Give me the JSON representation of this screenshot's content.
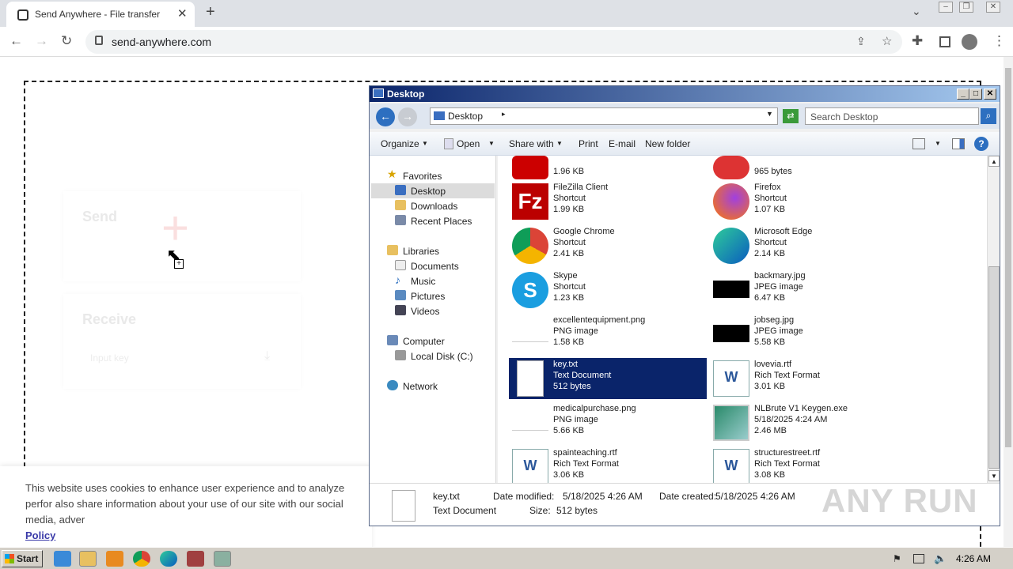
{
  "browser": {
    "tab_title": "Send Anywhere - File transfer",
    "url": "send-anywhere.com",
    "close": "✕",
    "new_tab": "+"
  },
  "page": {
    "send_heading": "Send",
    "receive_heading": "Receive",
    "receive_placeholder": "Input key",
    "cookie_text": "This website uses cookies to enhance user experience and to analyze perfor also share information about your use of our site with our social media, adver",
    "cookie_link": "Policy"
  },
  "explorer": {
    "title": "Desktop",
    "address": "Desktop",
    "search_placeholder": "Search Desktop",
    "commands": [
      "Organize",
      "Open",
      "Share with",
      "Print",
      "E-mail",
      "New folder"
    ],
    "nav": {
      "favorites": "Favorites",
      "desktop": "Desktop",
      "downloads": "Downloads",
      "recent": "Recent Places",
      "libraries": "Libraries",
      "documents": "Documents",
      "music": "Music",
      "pictures": "Pictures",
      "videos": "Videos",
      "computer": "Computer",
      "local_disk": "Local Disk (C:)",
      "network": "Network"
    },
    "files": [
      {
        "name": "",
        "type": "",
        "size": "1.96 KB"
      },
      {
        "name": "",
        "type": "",
        "size": "965 bytes"
      },
      {
        "name": "FileZilla Client",
        "type": "Shortcut",
        "size": "1.99 KB"
      },
      {
        "name": "Firefox",
        "type": "Shortcut",
        "size": "1.07 KB"
      },
      {
        "name": "Google Chrome",
        "type": "Shortcut",
        "size": "2.41 KB"
      },
      {
        "name": "Microsoft Edge",
        "type": "Shortcut",
        "size": "2.14 KB"
      },
      {
        "name": "Skype",
        "type": "Shortcut",
        "size": "1.23 KB"
      },
      {
        "name": "backmary.jpg",
        "type": "JPEG image",
        "size": "6.47 KB"
      },
      {
        "name": "excellentequipment.png",
        "type": "PNG image",
        "size": "1.58 KB"
      },
      {
        "name": "jobseg.jpg",
        "type": "JPEG image",
        "size": "5.58 KB"
      },
      {
        "name": "key.txt",
        "type": "Text Document",
        "size": "512 bytes"
      },
      {
        "name": "lovevia.rtf",
        "type": "Rich Text Format",
        "size": "3.01 KB"
      },
      {
        "name": "medicalpurchase.png",
        "type": "PNG image",
        "size": "5.66 KB"
      },
      {
        "name": "NLBrute V1 Keygen.exe",
        "type": "5/18/2025 4:24 AM",
        "size": "2.46 MB"
      },
      {
        "name": "spainteaching.rtf",
        "type": "Rich Text Format",
        "size": "3.06 KB"
      },
      {
        "name": "structurestreet.rtf",
        "type": "Rich Text Format",
        "size": "3.08 KB"
      }
    ],
    "details": {
      "name": "key.txt",
      "type": "Text Document",
      "modified_label": "Date modified:",
      "modified": "5/18/2025 4:26 AM",
      "created_label": "Date created:",
      "created": "5/18/2025 4:26 AM",
      "size_label": "Size:",
      "size": "512 bytes"
    }
  },
  "taskbar": {
    "start": "Start",
    "clock": "4:26 AM"
  },
  "watermark": "ANY RUN"
}
